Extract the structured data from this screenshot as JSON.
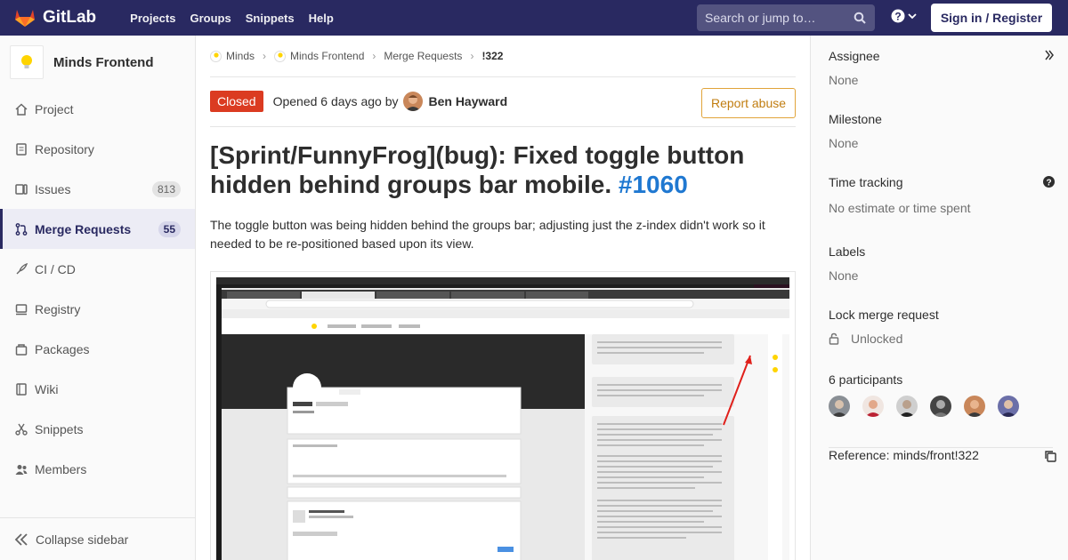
{
  "navbar": {
    "logo_text": "GitLab",
    "links": [
      "Projects",
      "Groups",
      "Snippets",
      "Help"
    ],
    "search_placeholder": "Search or jump to…",
    "signin_label": "Sign in / Register",
    "color": "#292961"
  },
  "sidebar": {
    "project_name": "Minds Frontend",
    "items": [
      {
        "label": "Project",
        "icon": "home-icon"
      },
      {
        "label": "Repository",
        "icon": "doc-icon"
      },
      {
        "label": "Issues",
        "icon": "issues-icon",
        "count": "813"
      },
      {
        "label": "Merge Requests",
        "icon": "merge-request-icon",
        "count": "55"
      },
      {
        "label": "CI / CD",
        "icon": "rocket-icon"
      },
      {
        "label": "Registry",
        "icon": "server-icon"
      },
      {
        "label": "Packages",
        "icon": "package-icon"
      },
      {
        "label": "Wiki",
        "icon": "book-icon"
      },
      {
        "label": "Snippets",
        "icon": "scissors-icon"
      },
      {
        "label": "Members",
        "icon": "users-icon"
      }
    ],
    "collapse_label": "Collapse sidebar"
  },
  "breadcrumb": [
    "Minds",
    "Minds Frontend",
    "Merge Requests",
    "!322"
  ],
  "mr": {
    "status": "Closed",
    "opened_text": "Opened 6 days ago by",
    "author": "Ben Hayward",
    "report_label": "Report abuse",
    "title": "[Sprint/FunnyFrog](bug): Fixed toggle button hidden behind groups bar mobile.",
    "issue_ref": "#1060",
    "description": "The toggle button was being hidden behind the groups bar; adjusting just the z-index didn't work so it needed to be re-positioned based upon its view.",
    "status_color": "#db3b21",
    "link_color": "#1f78d1"
  },
  "right_sidebar": {
    "assignee_label": "Assignee",
    "assignee_value": "None",
    "milestone_label": "Milestone",
    "milestone_value": "None",
    "time_label": "Time tracking",
    "time_value": "No estimate or time spent",
    "labels_label": "Labels",
    "labels_value": "None",
    "lock_label": "Lock merge request",
    "lock_value": "Unlocked",
    "participants_label": "6 participants",
    "reference_label": "Reference: minds/front!322"
  }
}
